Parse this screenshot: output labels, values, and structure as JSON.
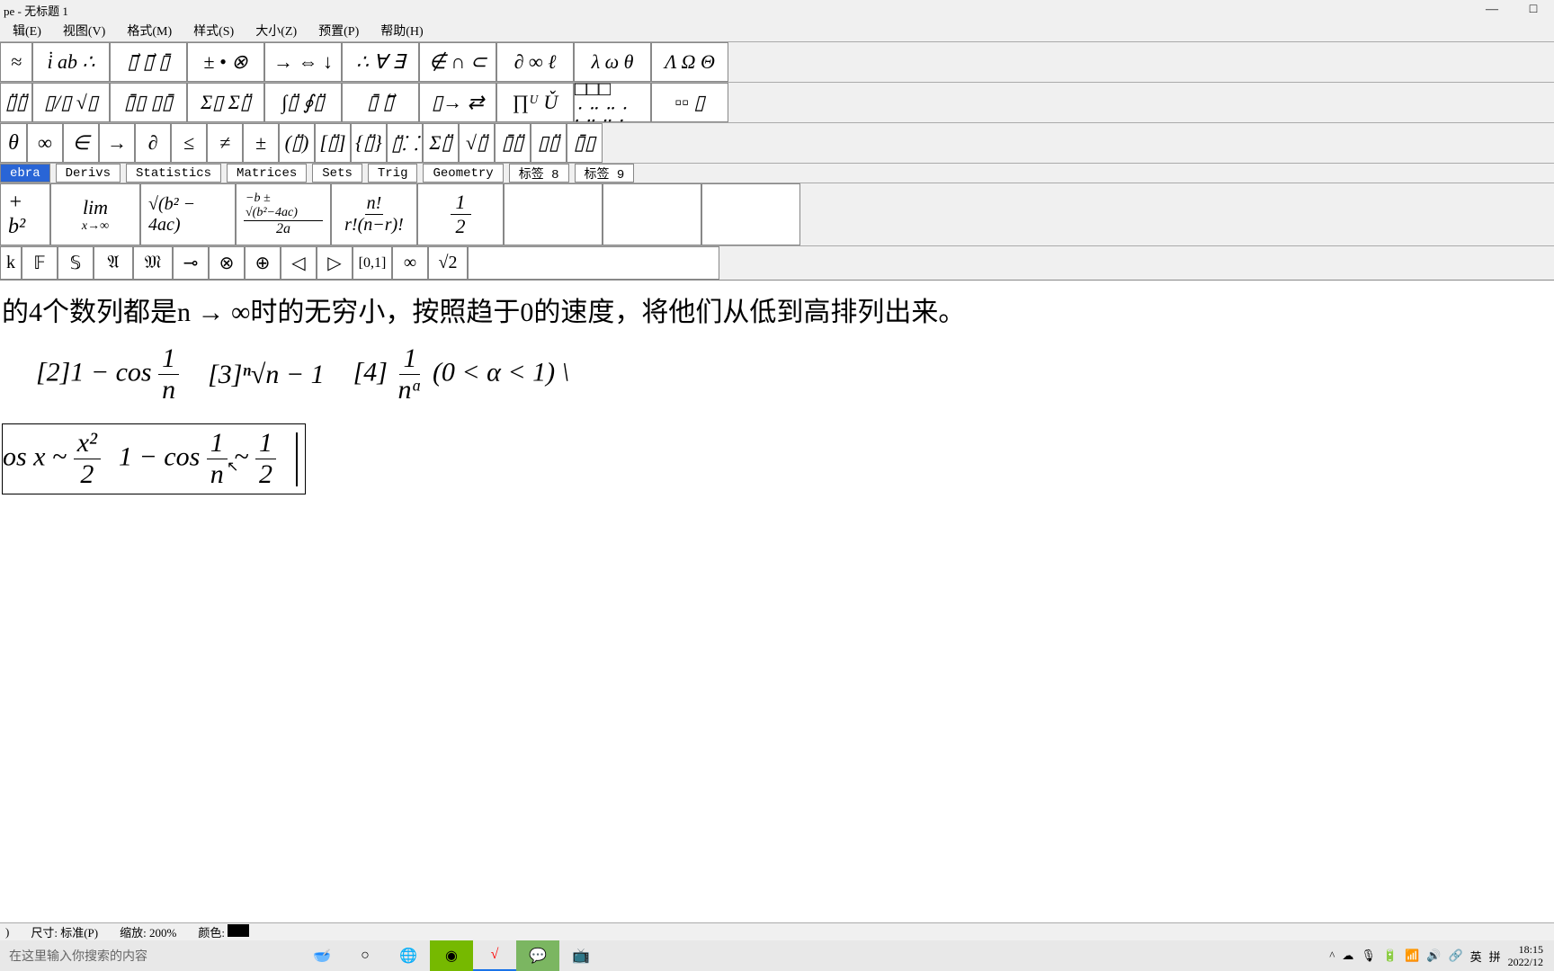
{
  "title": "pe - 无标题 1",
  "menu": {
    "edit": "辑(E)",
    "view": "视图(V)",
    "format": "格式(M)",
    "style": "样式(S)",
    "size": "大小(Z)",
    "preset": "预置(P)",
    "help": "帮助(H)"
  },
  "toolbar1": {
    "b0": "≈",
    "b1": "i̇ ab ∴",
    "b2": "▯⃗ ▯⃗ ▯̄",
    "b3": "± • ⊗",
    "b4": "→ ⇔ ↓",
    "b5": "∴ ∀ ∃",
    "b6": "∉ ∩ ⊂",
    "b7": "∂ ∞ ℓ",
    "b8": "λ ω θ",
    "b9": "Λ Ω Θ"
  },
  "toolbar2": {
    "b0": "▯̈▯̈",
    "b1": "▯/▯ √▯",
    "b2": "▯̄▯ ▯▯̄",
    "b3": "Σ▯ Σ▯̈",
    "b4": "∫▯̈ ∮▯̈",
    "b5": "▯̄ ▯⃡",
    "b6": "▯→ ⇄",
    "b7": "∏ᵁ Ǔ",
    "b8": "□□□ ⸬⸬⸬",
    "b9": "▫▫ ▯"
  },
  "toolbar3": {
    "b0": "θ",
    "b1": "∞",
    "b2": "∈",
    "b3": "→",
    "b4": "∂",
    "b5": "≤",
    "b6": "≠",
    "b7": "±",
    "b8": "(▯̈)",
    "b9": "[▯̈]",
    "b10": "{▯̈}",
    "b11": "▯̈⸬",
    "b12": "Σ▯̈",
    "b13": "√▯̈",
    "b14": "▯̄▯̈",
    "b15": "▯▯̈",
    "b16": "▯̄▯"
  },
  "tabs": {
    "algebra": "ebra",
    "derivs": "Derivs",
    "statistics": "Statistics",
    "matrices": "Matrices",
    "sets": "Sets",
    "trig": "Trig",
    "geometry": "Geometry",
    "tab8": "标签 8",
    "tab9": "标签 9"
  },
  "templates": {
    "t0": "+ b²",
    "t1_top": "lim",
    "t1_bot": "x→∞",
    "t2": "√(b² − 4ac)",
    "t3_top": "−b ± √(b²−4ac)",
    "t3_bot": "2a",
    "t4_top": "n!",
    "t4_bot": "r!(n−r)!",
    "t5_top": "1",
    "t5_bot": "2"
  },
  "symbols": {
    "s0": "k",
    "s1": "𝔽",
    "s2": "𝕊",
    "s3": "𝔄",
    "s4": "𝔐",
    "s5": "⊸",
    "s6": "⊗",
    "s7": "⊕",
    "s8": "◁",
    "s9": "▷",
    "s10": "[0,1]",
    "s11": "∞",
    "s12": "√2"
  },
  "content": {
    "line1": "的4个数列都是n → ∞时的无穷小，按照趋于0的速度，将他们从低到高排列出来。",
    "item2_pre": "[2]1 − cos",
    "item2_num": "1",
    "item2_den": "n",
    "item3_pre": "[3]",
    "item3_root": "ⁿ√n",
    "item3_post": " − 1",
    "item4_pre": "[4]",
    "item4_num": "1",
    "item4_den": "nᵅ",
    "item4_post": "(0 < α < 1) \\",
    "line3_a": "os x ~ ",
    "line3_a_num": "x²",
    "line3_a_den": "2",
    "line3_b": "1 − cos",
    "line3_b_num": "1",
    "line3_b_den": "n",
    "line3_tilde": "~",
    "line3_c_num": "1",
    "line3_c_den": "2"
  },
  "statusbar": {
    "first": ")",
    "size": "尺寸: 标准(P)",
    "zoom": "缩放: 200%",
    "color": "颜色:"
  },
  "taskbar": {
    "search_placeholder": "在这里输入你搜索的内容",
    "ime": "英",
    "pinyin": "拼",
    "time": "18:15",
    "date": "2022/12"
  }
}
